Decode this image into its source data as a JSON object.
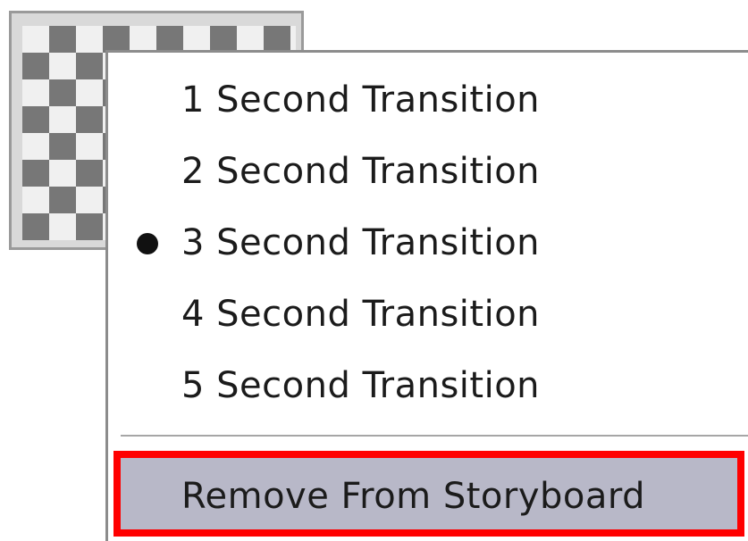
{
  "thumbnail": {
    "icon": "checkerboard-transition-icon"
  },
  "context_menu": {
    "items": [
      {
        "label": "1 Second Transition",
        "selected": false
      },
      {
        "label": "2 Second Transition",
        "selected": false
      },
      {
        "label": "3 Second Transition",
        "selected": true
      },
      {
        "label": "4 Second Transition",
        "selected": false
      },
      {
        "label": "5 Second Transition",
        "selected": false
      }
    ],
    "remove_item": {
      "label": "Remove From Storyboard",
      "highlight_color": "#ff0000"
    }
  }
}
